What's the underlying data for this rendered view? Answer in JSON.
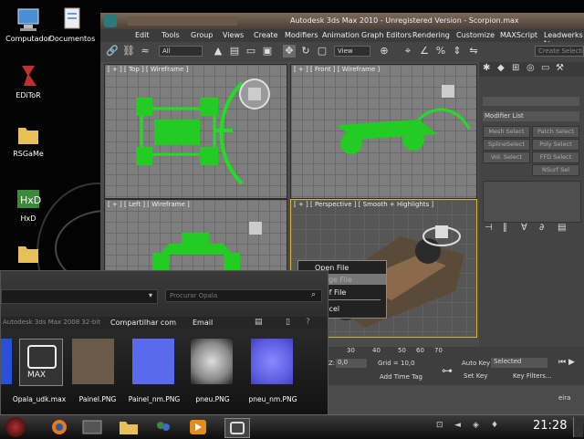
{
  "desktop": {
    "icons": [
      {
        "label": "Computador"
      },
      {
        "label": "Documentos"
      },
      {
        "label": "EDiToR"
      },
      {
        "label": "RSGaMe"
      },
      {
        "label": "HxD"
      }
    ]
  },
  "max": {
    "title": "Autodesk 3ds Max 2010  -  Unregistered Version  -  Scorpion.max",
    "menus": [
      "Edit",
      "Tools",
      "Group",
      "Views",
      "Create",
      "Modifiers",
      "Animation",
      "Graph Editors",
      "Rendering",
      "Customize",
      "MAXScript",
      "Leadwerks to"
    ],
    "toolbar": {
      "filter": "All",
      "view": "View",
      "selection_set": "Create Selection"
    },
    "viewports": [
      {
        "label": "[ + ] [ Top ] [ Wireframe ]"
      },
      {
        "label": "[ + ] [ Front ] [ Wireframe ]"
      },
      {
        "label": "[ + ] [ Left ] [ Wireframe ]"
      },
      {
        "label": "[ + ] [ Perspective ] [ Smooth + Highlights ]"
      }
    ],
    "command_panel": {
      "modifier_list": "Modifier List",
      "buttons": [
        "Mesh Select",
        "Patch Select",
        "SplineSelect",
        "Poly Select",
        "Vol. Select",
        "FFD Select",
        "NSurf Sel"
      ]
    },
    "context_menu": [
      "Open File",
      "Merge File",
      "XRef File",
      "Cancel"
    ],
    "timeline": {
      "ticks": [
        "30",
        "40",
        "50",
        "60",
        "70"
      ],
      "x_field": "0,0",
      "grid": "Grid = 10,0",
      "add_time_tag": "Add Time Tag",
      "auto_key": "Auto Key",
      "selected": "Selected",
      "set_key": "Set Key",
      "key_filters": "Key Filters..."
    }
  },
  "explorer": {
    "search_placeholder": "Procurar Opala",
    "header_left": "Autodesk 3ds Max 2008 32-bit",
    "share": "Compartilhar com",
    "email": "Email",
    "files": [
      {
        "name": "Opala_udk.max"
      },
      {
        "name": "Painel.PNG"
      },
      {
        "name": "Painel_nm.PNG"
      },
      {
        "name": "pneu.PNG"
      },
      {
        "name": "pneu_nm.PNG"
      }
    ],
    "max_badge": "MAX"
  },
  "taskbar": {
    "clock": "21:28",
    "extra_label": "eira"
  }
}
